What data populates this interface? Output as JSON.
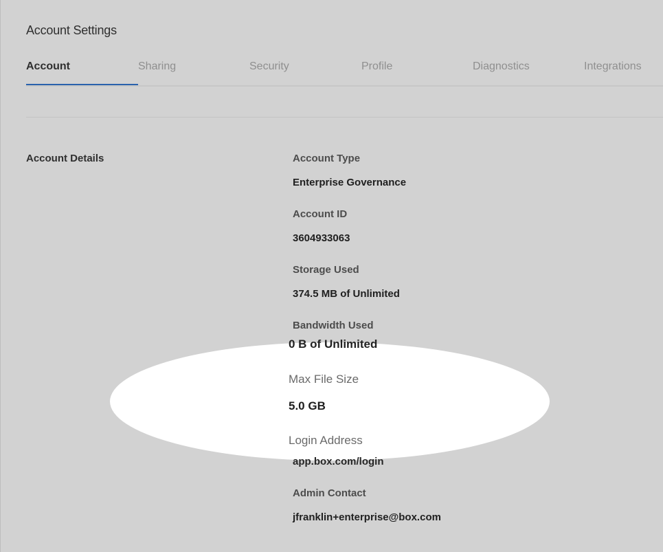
{
  "page": {
    "title": "Account Settings"
  },
  "tabs": [
    {
      "label": "Account",
      "active": true
    },
    {
      "label": "Sharing",
      "active": false
    },
    {
      "label": "Security",
      "active": false
    },
    {
      "label": "Profile",
      "active": false
    },
    {
      "label": "Diagnostics",
      "active": false
    },
    {
      "label": "Integrations",
      "active": false
    }
  ],
  "account_details": {
    "section_title": "Account Details",
    "items": [
      {
        "label": "Account Type",
        "value": "Enterprise Governance"
      },
      {
        "label": "Account ID",
        "value": "3604933063"
      },
      {
        "label": "Storage Used",
        "value": "374.5 MB of Unlimited"
      },
      {
        "label": "Bandwidth Used",
        "value": "0 B of Unlimited"
      },
      {
        "label": "Max File Size",
        "value": "5.0 GB"
      },
      {
        "label": "Login Address",
        "value": "app.box.com/login"
      },
      {
        "label": "Admin Contact",
        "value": "jfranklin+enterprise@box.com"
      }
    ]
  },
  "colors": {
    "background": "#d2d2d2",
    "accent": "#2a62ad",
    "spotlight": "#ffffff"
  }
}
